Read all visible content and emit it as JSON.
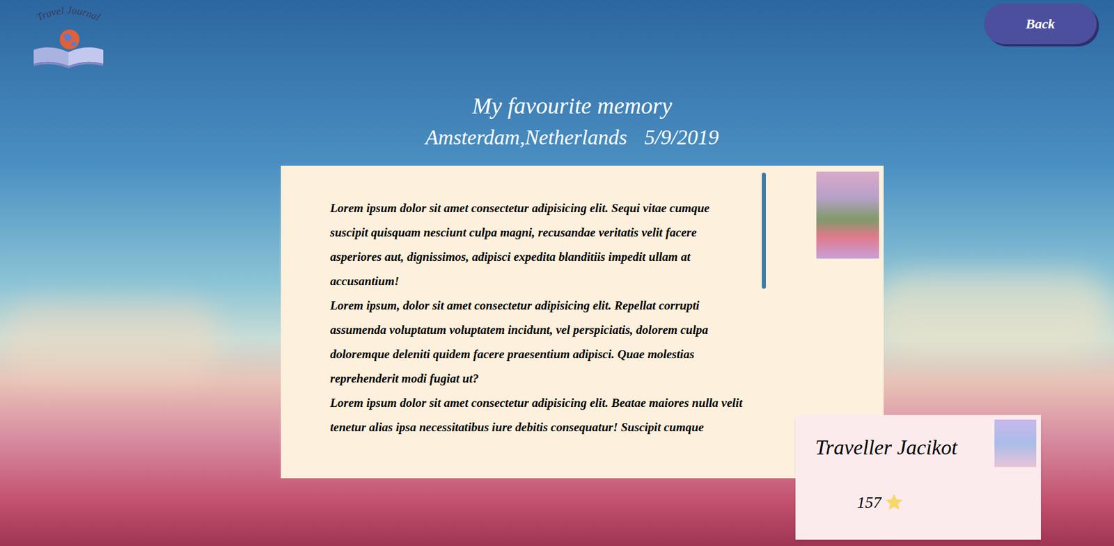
{
  "logo": {
    "text": "Travel Journal"
  },
  "back_button": {
    "label": "Back"
  },
  "memory": {
    "title": "My favourite memory",
    "location": "Amsterdam,Netherlands",
    "date": "5/9/2019",
    "paragraphs": [
      "Lorem ipsum dolor sit amet consectetur adipisicing elit. Sequi vitae cumque suscipit quisquam nesciunt culpa magni, recusandae veritatis velit facere asperiores aut, dignissimos, adipisci expedita blanditiis impedit ullam at accusantium!",
      "Lorem ipsum, dolor sit amet consectetur adipisicing elit. Repellat corrupti assumenda voluptatum voluptatem incidunt, vel perspiciatis, dolorem culpa doloremque deleniti quidem facere praesentium adipisci. Quae molestias reprehenderit modi fugiat ut?",
      "Lorem ipsum dolor sit amet consectetur adipisicing elit. Beatae maiores nulla velit tenetur alias ipsa necessitatibus iure debitis consequatur! Suscipit cumque"
    ]
  },
  "author": {
    "name": "Traveller Jacikot",
    "likes": "157"
  }
}
